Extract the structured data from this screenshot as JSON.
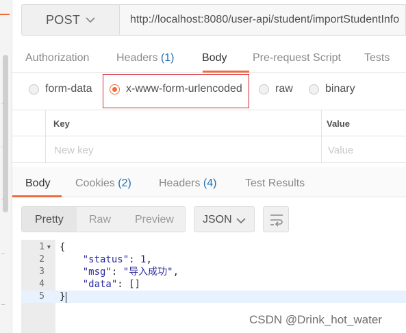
{
  "request": {
    "method": "POST",
    "url": "http://localhost:8080/user-api/student/importStudentInfo"
  },
  "request_tabs": [
    {
      "label": "Authorization",
      "count": ""
    },
    {
      "label": "Headers ",
      "count": "(1)"
    },
    {
      "label": "Body",
      "count": "",
      "active": true
    },
    {
      "label": "Pre-request Script",
      "count": ""
    },
    {
      "label": "Tests",
      "count": ""
    }
  ],
  "body_types": [
    {
      "label": "form-data",
      "checked": false
    },
    {
      "label": "x-www-form-urlencoded",
      "checked": true
    },
    {
      "label": "raw",
      "checked": false
    },
    {
      "label": "binary",
      "checked": false
    }
  ],
  "kv_table": {
    "key_header": "Key",
    "value_header": "Value",
    "key_placeholder": "New key",
    "value_placeholder": "Value"
  },
  "response_tabs": [
    {
      "label": "Body",
      "count": "",
      "active": true
    },
    {
      "label": "Cookies ",
      "count": "(2)"
    },
    {
      "label": "Headers ",
      "count": "(4)"
    },
    {
      "label": "Test Results",
      "count": ""
    }
  ],
  "view_toolbar": {
    "modes": [
      "Pretty",
      "Raw",
      "Preview"
    ],
    "active_mode": "Pretty",
    "format": "JSON",
    "wrap_icon": "wrap-lines-icon"
  },
  "code_lines": [
    {
      "n": "1",
      "fold": true
    },
    {
      "n": "2"
    },
    {
      "n": "3"
    },
    {
      "n": "4"
    },
    {
      "n": "5",
      "current": true
    }
  ],
  "response_json": {
    "line1": "{",
    "status_key": "\"status\"",
    "status_val": "1",
    "msg_key": "\"msg\"",
    "msg_val": "\"导入成功\"",
    "data_key": "\"data\"",
    "data_val": "[]",
    "line5": "}"
  },
  "watermark": "CSDN @Drink_hot_water",
  "colors": {
    "accent": "#f26b3a",
    "highlight_border": "#d4232f",
    "count_blue": "#1f6fb4"
  }
}
